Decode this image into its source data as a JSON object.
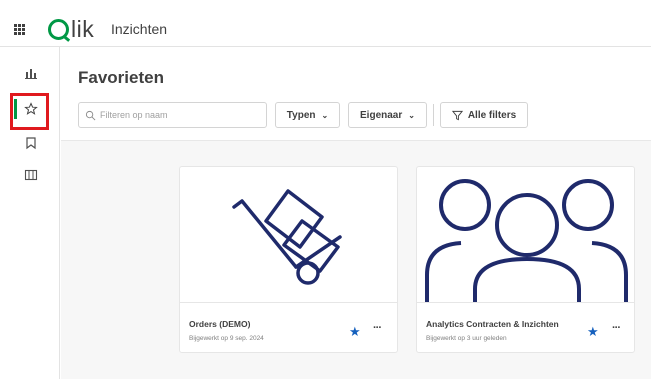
{
  "header": {
    "logo_text": "lik",
    "app_title": "Inzichten"
  },
  "sidebar": {
    "items": [
      {
        "icon": "analytics-icon"
      },
      {
        "icon": "star-icon",
        "active": true
      },
      {
        "icon": "bookmark-icon"
      },
      {
        "icon": "catalog-icon"
      }
    ]
  },
  "main": {
    "title": "Favorieten",
    "search": {
      "placeholder": "Filteren op naam",
      "value": ""
    },
    "filters": {
      "type_label": "Typen",
      "owner_label": "Eigenaar",
      "all_filters_label": "Alle filters"
    }
  },
  "cards": [
    {
      "title": "Orders (DEMO)",
      "subtitle": "Bijgewerkt op 9 sep. 2024",
      "thumbnail_icon": "hand-truck-icon",
      "favorite": true
    },
    {
      "title": "Analytics Contracten & Inzichten",
      "subtitle": "Bijgewerkt op 3 uur geleden",
      "thumbnail_icon": "users-group-icon",
      "favorite": true
    }
  ],
  "colors": {
    "brand_green": "#009845",
    "highlight_red": "#e0191e",
    "star_blue": "#1560bd",
    "illustration_navy": "#1f2a6b"
  }
}
